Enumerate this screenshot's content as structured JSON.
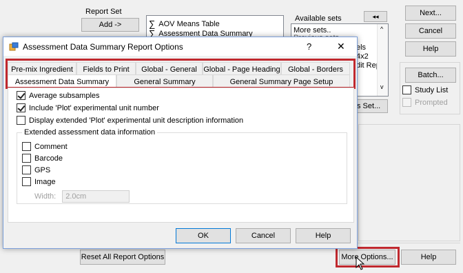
{
  "background": {
    "report_set": {
      "label": "Report Set",
      "add_button": "Add ->",
      "items": [
        "AOV Means Table",
        "Assessment Data Summary"
      ]
    },
    "available_sets": {
      "label": "Available sets",
      "collapse_button": "◂◂",
      "items": [
        "More sets..",
        "Previous sets"
      ],
      "partial_right_items": [
        "els",
        "4x2",
        "dit Rep"
      ],
      "set_button_partial": "s Set..."
    },
    "right_buttons": {
      "next": "Next...",
      "cancel": "Cancel",
      "help": "Help",
      "batch": "Batch...",
      "study_list": "Study List",
      "prompted": "Prompted"
    },
    "bottom": {
      "reset_button": "Reset All Report Options",
      "more_options_button": "More Options...",
      "help_button": "Help"
    }
  },
  "dialog": {
    "title": "Assessment Data Summary Report Options",
    "help_glyph": "?",
    "close_glyph": "✕",
    "tabs_back_row": [
      "Pre-mix Ingredient",
      "Fields to Print",
      "Global - General",
      "Global - Page Heading",
      "Global - Borders"
    ],
    "tabs_front_row": [
      "Assessment Data Summary",
      "General Summary",
      "General Summary Page Setup"
    ],
    "options": [
      {
        "label": "Average subsamples",
        "checked": true
      },
      {
        "label": "Include 'Plot' experimental unit number",
        "checked": true
      },
      {
        "label": "Display extended 'Plot' experimental unit description information",
        "checked": false
      }
    ],
    "extended_group": {
      "label": "Extended assessment data information",
      "items": [
        {
          "label": "Comment",
          "checked": false
        },
        {
          "label": "Barcode",
          "checked": false
        },
        {
          "label": "GPS",
          "checked": false
        },
        {
          "label": "Image",
          "checked": false
        }
      ],
      "width_label": "Width:",
      "width_value": "2.0cm"
    },
    "buttons": {
      "ok": "OK",
      "cancel": "Cancel",
      "help": "Help"
    }
  },
  "colors": {
    "highlight": "#c0282e",
    "accent": "#0078d7"
  }
}
